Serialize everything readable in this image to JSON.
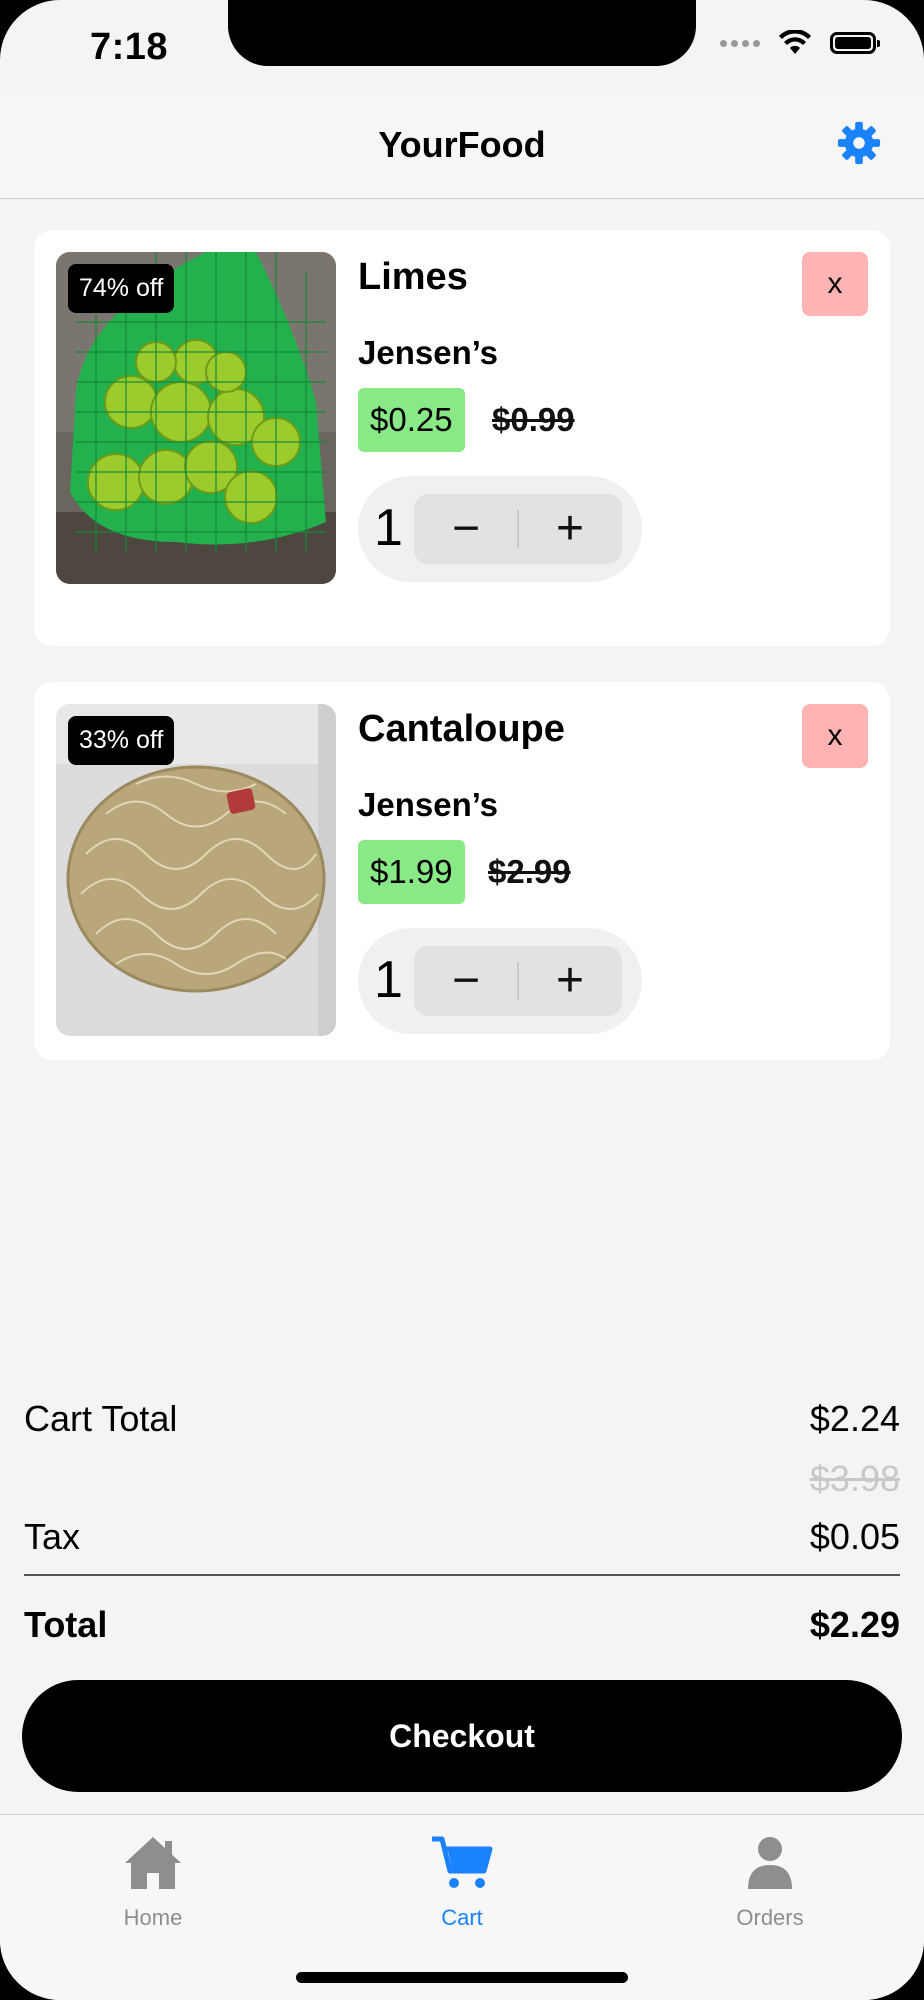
{
  "status": {
    "time": "7:18"
  },
  "header": {
    "title": "YourFood",
    "settings_icon": "gear-icon",
    "accent": "#1a82fb"
  },
  "cart_items": [
    {
      "badge": "74% off",
      "name": "Limes",
      "store": "Jensen’s",
      "price": "$0.25",
      "original_price": "$0.99",
      "quantity": "1",
      "remove_label": "x",
      "image": "limes-photo"
    },
    {
      "badge": "33% off",
      "name": "Cantaloupe",
      "store": "Jensen’s",
      "price": "$1.99",
      "original_price": "$2.99",
      "quantity": "1",
      "remove_label": "x",
      "image": "cantaloupe-photo"
    }
  ],
  "stepper": {
    "minus": "−",
    "plus": "+"
  },
  "summary": {
    "cart_total_label": "Cart Total",
    "cart_total": "$2.24",
    "cart_total_original": "$3.98",
    "tax_label": "Tax",
    "tax": "$0.05",
    "total_label": "Total",
    "total": "$2.29"
  },
  "checkout_label": "Checkout",
  "tabs": [
    {
      "label": "Home",
      "icon": "home-icon",
      "active": false
    },
    {
      "label": "Cart",
      "icon": "cart-icon",
      "active": true
    },
    {
      "label": "Orders",
      "icon": "person-icon",
      "active": false
    }
  ],
  "colors": {
    "price_bg": "#8ae987",
    "remove_bg": "#ffb3b3",
    "active_tab": "#1a82fb",
    "inactive_tab": "#8e8e8e"
  }
}
